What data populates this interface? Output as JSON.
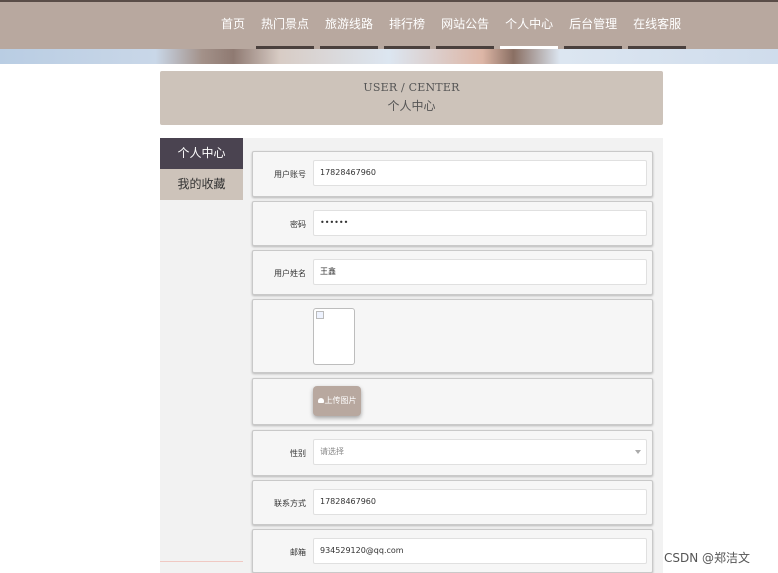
{
  "nav": {
    "items": [
      {
        "label": "首页"
      },
      {
        "label": "热门景点"
      },
      {
        "label": "旅游线路"
      },
      {
        "label": "排行榜"
      },
      {
        "label": "网站公告"
      },
      {
        "label": "个人中心"
      },
      {
        "label": "后台管理"
      },
      {
        "label": "在线客服"
      }
    ],
    "active": "个人中心"
  },
  "header": {
    "title_en": "USER / CENTER",
    "title_cn": "个人中心"
  },
  "sidebar": {
    "items": [
      {
        "label": "个人中心"
      },
      {
        "label": "我的收藏"
      }
    ]
  },
  "form": {
    "account": {
      "label": "用户账号",
      "value": "17828467960"
    },
    "password": {
      "label": "密码",
      "value": "••••••"
    },
    "name": {
      "label": "用户姓名",
      "value": "王鑫"
    },
    "upload": {
      "label": "上传图片",
      "icon": "cloud-upload-icon"
    },
    "gender": {
      "label": "性别",
      "placeholder": "请选择"
    },
    "phone": {
      "label": "联系方式",
      "value": "17828467960"
    },
    "email": {
      "label": "邮箱",
      "value": "934529120@qq.com"
    }
  },
  "watermark": "CSDN @郑洁文",
  "colors": {
    "topbar": "#b8a89f",
    "active_menu": "#4a4350",
    "card": "#cdc3ba"
  }
}
